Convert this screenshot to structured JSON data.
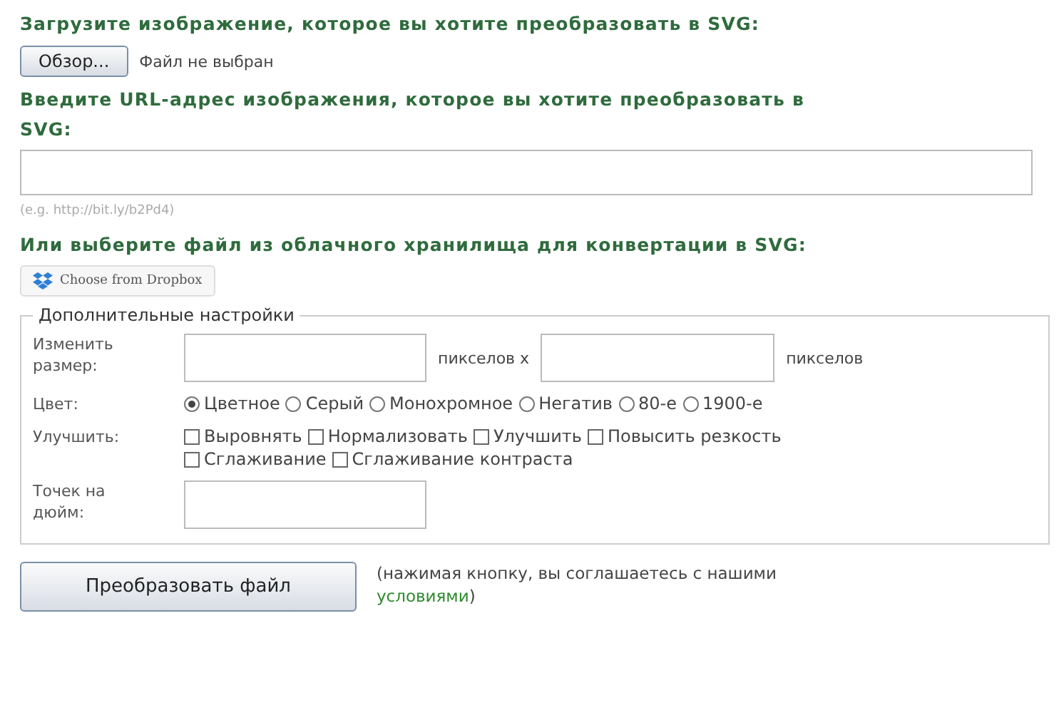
{
  "upload": {
    "heading": "Загрузите изображение, которое вы хотите преобразовать в SVG:",
    "browse_button": "Обзор...",
    "file_status": "Файл не выбран"
  },
  "url": {
    "heading": "Введите URL-адрес изображения, которое вы хотите преобразовать в SVG:",
    "hint": "(e.g. http://bit.ly/b2Pd4)"
  },
  "cloud": {
    "heading": "Или выберите файл из облачного хранилища для конвертации в SVG:",
    "dropbox_button": "Choose from Dropbox"
  },
  "settings": {
    "legend": "Дополнительные настройки",
    "resize": {
      "label": "Изменить размер:",
      "unit_x": "пикселов x",
      "unit": "пикселов"
    },
    "color": {
      "label": "Цвет:",
      "options": [
        {
          "label": "Цветное",
          "selected": true
        },
        {
          "label": "Серый",
          "selected": false
        },
        {
          "label": "Монохромное",
          "selected": false
        },
        {
          "label": "Негатив",
          "selected": false
        },
        {
          "label": "80-е",
          "selected": false
        },
        {
          "label": "1900-е",
          "selected": false
        }
      ]
    },
    "enhance": {
      "label": "Улучшить:",
      "options": [
        {
          "label": "Выровнять",
          "checked": false
        },
        {
          "label": "Нормализовать",
          "checked": false
        },
        {
          "label": "Улучшить",
          "checked": false
        },
        {
          "label": "Повысить резкость",
          "checked": false
        },
        {
          "label": "Сглаживание",
          "checked": false
        },
        {
          "label": "Сглаживание контраста",
          "checked": false
        }
      ]
    },
    "dpi": {
      "label": "Точек на дюйм:"
    }
  },
  "convert": {
    "button": "Преобразовать файл",
    "note_before": "(нажимая кнопку, вы соглашаетесь с нашими ",
    "link": "условиями",
    "note_after": ")"
  }
}
